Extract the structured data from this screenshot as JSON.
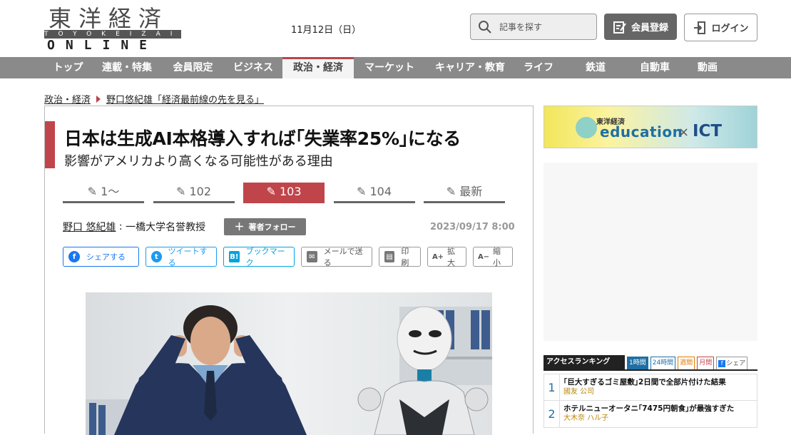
{
  "logo": {
    "kanji": "東洋経済",
    "roman": "TOYOKEIZAI",
    "online": "ONLINE"
  },
  "header": {
    "date": "11月12日（日）",
    "search_placeholder": "記事を探す",
    "member_register": "会員登録",
    "login": "ログイン"
  },
  "nav": [
    "トップ",
    "連載・特集",
    "会員限定",
    "ビジネス",
    "政治・経済",
    "マーケット",
    "キャリア・教育",
    "ライフ",
    "鉄道",
    "自動車",
    "動画"
  ],
  "nav_active": "政治・経済",
  "breadcrumb": {
    "section": "政治・経済",
    "series": "野口悠紀雄「経済最前線の先を見る」"
  },
  "article": {
    "title": "日本は生成AI本格導入すれば｢失業率25%｣になる",
    "subtitle": "影響がアメリカより高くなる可能性がある理由",
    "pages": [
      "1〜",
      "102",
      "103",
      "104",
      "最新"
    ],
    "active_page": "103",
    "author_name": "野口 悠紀雄",
    "author_title": "一橋大学名誉教授",
    "follow_label": "著者フォロー",
    "published": "2023/09/17 8:00"
  },
  "share": [
    {
      "label": "シェアする",
      "icon": "facebook-icon",
      "color": "#1877f2"
    },
    {
      "label": "ツイートする",
      "icon": "twitter-icon",
      "color": "#1d9bf0"
    },
    {
      "label": "ブックマーク",
      "icon": "hatena-bookmark-icon",
      "color": "#00a4de"
    },
    {
      "label": "メールで送る",
      "icon": "mail-icon",
      "color": "#777777"
    },
    {
      "label": "印刷",
      "icon": "print-icon",
      "color": "#777777"
    },
    {
      "label": "拡大",
      "icon": "zoom-in-icon",
      "color": "#777777"
    },
    {
      "label": "縮小",
      "icon": "zoom-out-icon",
      "color": "#777777"
    }
  ],
  "ad": {
    "brand": "東洋経済",
    "edu": "education",
    "cross": "×",
    "ict": "ICT"
  },
  "ranking": {
    "title": "アクセスランキング",
    "tabs": [
      "1時間",
      "24時間",
      "週間",
      "月間",
      "シェア"
    ],
    "items": [
      {
        "rank": "1",
        "text": "｢巨大すぎるゴミ屋敷｣2日間で全部片付けた結果",
        "author": "國友 公司"
      },
      {
        "rank": "2",
        "text": "ホテルニューオータニ｢7475円朝食｣が最強すぎた",
        "author": "大木奈 ハル子"
      }
    ]
  },
  "colors": {
    "accent": "#c0454b",
    "nav_bg": "#8a8a8a"
  }
}
